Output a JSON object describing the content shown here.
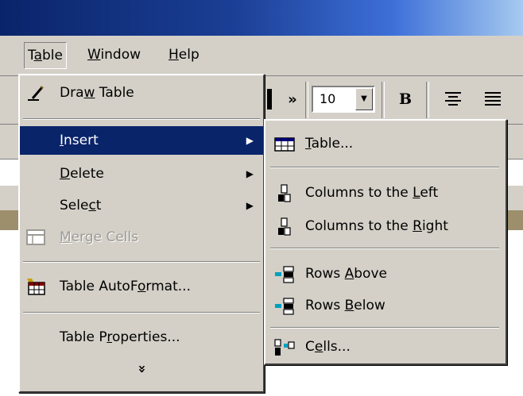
{
  "menubar": {
    "items": [
      {
        "pre": "T",
        "ul": "a",
        "post": "ble"
      },
      {
        "pre": "",
        "ul": "W",
        "post": "indow"
      },
      {
        "pre": "",
        "ul": "H",
        "post": "elp"
      }
    ]
  },
  "toolbar": {
    "font_size_value": "10",
    "bold_label": "B",
    "more_label": "»"
  },
  "table_menu": {
    "draw_table": {
      "pre": "Dra",
      "ul": "w",
      "post": " Table"
    },
    "insert": {
      "pre": "",
      "ul": "I",
      "post": "nsert"
    },
    "delete": {
      "pre": "",
      "ul": "D",
      "post": "elete"
    },
    "select": {
      "pre": "Sele",
      "ul": "c",
      "post": "t"
    },
    "merge_cells": {
      "pre": "",
      "ul": "M",
      "post": "erge Cells"
    },
    "autoformat": {
      "pre": "Table AutoF",
      "ul": "o",
      "post": "rmat..."
    },
    "properties": {
      "pre": "Table P",
      "ul": "r",
      "post": "operties..."
    },
    "expand_label": "»"
  },
  "insert_submenu": {
    "table": {
      "pre": "",
      "ul": "T",
      "post": "able..."
    },
    "columns_left": {
      "pre": "Columns to the ",
      "ul": "L",
      "post": "eft"
    },
    "columns_right": {
      "pre": "Columns to the ",
      "ul": "R",
      "post": "ight"
    },
    "rows_above": {
      "pre": "Rows ",
      "ul": "A",
      "post": "bove"
    },
    "rows_below": {
      "pre": "Rows ",
      "ul": "B",
      "post": "elow"
    },
    "cells": {
      "pre": "C",
      "ul": "e",
      "post": "lls..."
    }
  },
  "colors": {
    "menu_face": "#d4d0c8",
    "highlight": "#0a246a",
    "title_start": "#0a246a",
    "title_end": "#a6caf0"
  }
}
